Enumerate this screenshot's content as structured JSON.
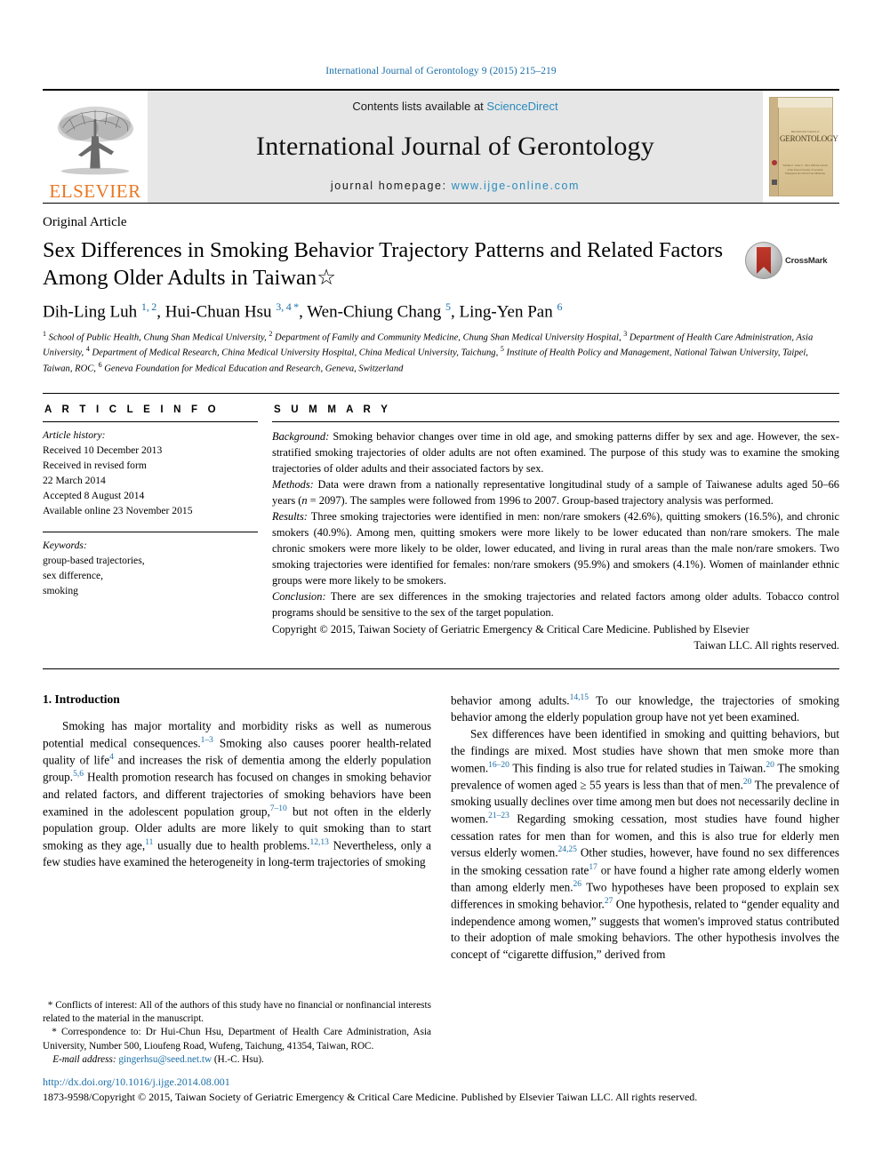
{
  "running_head": "International Journal of Gerontology 9 (2015) 215–219",
  "masthead": {
    "contents_prefix": "Contents lists available at ",
    "sciencedirect": "ScienceDirect",
    "journal_title": "International Journal of Gerontology",
    "homepage_label": "journal homepage: ",
    "homepage_url": "www.ijge-online.com",
    "publisher_logo_text": "ELSEVIER",
    "cover_line_small": "International Journal of",
    "cover_line_big": "GERONTOLOGY",
    "cover_footer": "Volume 9 · Issue 3 · 2015\nOfficial Journal of the Taiwan Society of Geriatric\nEmergency & Critical Care Medicine",
    "accent_link_color": "#2b8bbd",
    "elsevier_orange": "#e87722"
  },
  "article": {
    "type": "Original Article",
    "title": "Sex Differences in Smoking Behavior Trajectory Patterns and Related Factors Among Older Adults in Taiwan☆",
    "crossmark_label": "CrossMark",
    "authors_html": "Dih-Ling Luh <sup>1, 2</sup>, Hui-Chuan Hsu <sup>3, 4 *</sup>, Wen-Chiung Chang <sup>5</sup>, Ling-Yen Pan <sup>6</sup>",
    "affiliations_html": "<sup>1</sup> School of Public Health, Chung Shan Medical University, <sup>2</sup> Department of Family and Community Medicine, Chung Shan Medical University Hospital, <sup>3</sup> Department of Health Care Administration, Asia University, <sup>4</sup> Department of Medical Research, China Medical University Hospital, China Medical University, Taichung, <sup>5</sup> Institute of Health Policy and Management, National Taiwan University, Taipei, Taiwan, ROC, <sup>6</sup> Geneva Foundation for Medical Education and Research, Geneva, Switzerland"
  },
  "info": {
    "heading": "A R T I C L E  I N F O",
    "history_label": "Article history:",
    "history_lines": [
      "Received 10 December 2013",
      "Received in revised form",
      "22 March 2014",
      "Accepted 8 August 2014",
      "Available online 23 November 2015"
    ],
    "keywords_label": "Keywords:",
    "keywords": [
      "group-based trajectories,",
      "sex difference,",
      "smoking"
    ]
  },
  "summary": {
    "heading": "S U M M A R Y",
    "background_label": "Background:",
    "background_text": " Smoking behavior changes over time in old age, and smoking patterns differ by sex and age. However, the sex-stratified smoking trajectories of older adults are not often examined. The purpose of this study was to examine the smoking trajectories of older adults and their associated factors by sex.",
    "methods_label": "Methods:",
    "methods_text_html": " Data were drawn from a nationally representative longitudinal study of a sample of Taiwanese adults aged 50–66 years (<i>n</i> = 2097). The samples were followed from 1996 to 2007. Group-based trajectory analysis was performed.",
    "results_label": "Results:",
    "results_text": " Three smoking trajectories were identified in men: non/rare smokers (42.6%), quitting smokers (16.5%), and chronic smokers (40.9%). Among men, quitting smokers were more likely to be lower educated than non/rare smokers. The male chronic smokers were more likely to be older, lower educated, and living in rural areas than the male non/rare smokers. Two smoking trajectories were identified for females: non/rare smokers (95.9%) and smokers (4.1%). Women of mainlander ethnic groups were more likely to be smokers.",
    "conclusion_label": "Conclusion:",
    "conclusion_text": " There are sex differences in the smoking trajectories and related factors among older adults. Tobacco control programs should be sensitive to the sex of the target population.",
    "copyright_line1": "Copyright © 2015, Taiwan Society of Geriatric Emergency & Critical Care Medicine. Published by Elsevier",
    "copyright_line2": "Taiwan LLC. All rights reserved."
  },
  "body": {
    "section_title": "1. Introduction",
    "left_paragraphs_html": [
      "Smoking has major mortality and morbidity risks as well as numerous potential medical consequences.<sup>1–3</sup> Smoking also causes poorer health-related quality of life<sup>4</sup> and increases the risk of dementia among the elderly population group.<sup>5,6</sup> Health promotion research has focused on changes in smoking behavior and related factors, and different trajectories of smoking behaviors have been examined in the adolescent population group,<sup>7–10</sup> but not often in the elderly population group. Older adults are more likely to quit smoking than to start smoking as they age,<sup>11</sup> usually due to health problems.<sup>12,13</sup> Nevertheless, only a few studies have examined the heterogeneity in long-term trajectories of smoking"
    ],
    "right_paragraphs_html": [
      "behavior among adults.<sup>14,15</sup> To our knowledge, the trajectories of smoking behavior among the elderly population group have not yet been examined.",
      "Sex differences have been identified in smoking and quitting behaviors, but the findings are mixed. Most studies have shown that men smoke more than women.<sup>16–20</sup> This finding is also true for related studies in Taiwan.<sup>20</sup> The smoking prevalence of women aged ≥ 55 years is less than that of men.<sup>20</sup> The prevalence of smoking usually declines over time among men but does not necessarily decline in women.<sup>21–23</sup> Regarding smoking cessation, most studies have found higher cessation rates for men than for women, and this is also true for elderly men versus elderly women.<sup>24,25</sup> Other studies, however, have found no sex differences in the smoking cessation rate<sup>17</sup> or have found a higher rate among elderly women than among elderly men.<sup>26</sup> Two hypotheses have been proposed to explain sex differences in smoking behavior.<sup>27</sup> One hypothesis, related to “gender equality and independence among women,” suggests that women's improved status contributed to their adoption of male smoking behaviors. The other hypothesis involves the concept of “cigarette diffusion,” derived from"
    ]
  },
  "footnotes": {
    "conflict": "Conflicts of interest: All of the authors of this study have no financial or nonfinancial interests related to the material in the manuscript.",
    "correspondence": "Correspondence to: Dr Hui-Chun Hsu, Department of Health Care Administration, Asia University, Number 500, Lioufeng Road, Wufeng, Taichung, 41354, Taiwan, ROC.",
    "email_label": "E-mail address:",
    "email": "gingerhsu@seed.net.tw",
    "email_suffix": "(H.-C. Hsu)."
  },
  "bottom": {
    "doi": "http://dx.doi.org/10.1016/j.ijge.2014.08.001",
    "issn_line": "1873-9598/Copyright © 2015, Taiwan Society of Geriatric Emergency & Critical Care Medicine. Published by Elsevier Taiwan LLC. All rights reserved."
  }
}
